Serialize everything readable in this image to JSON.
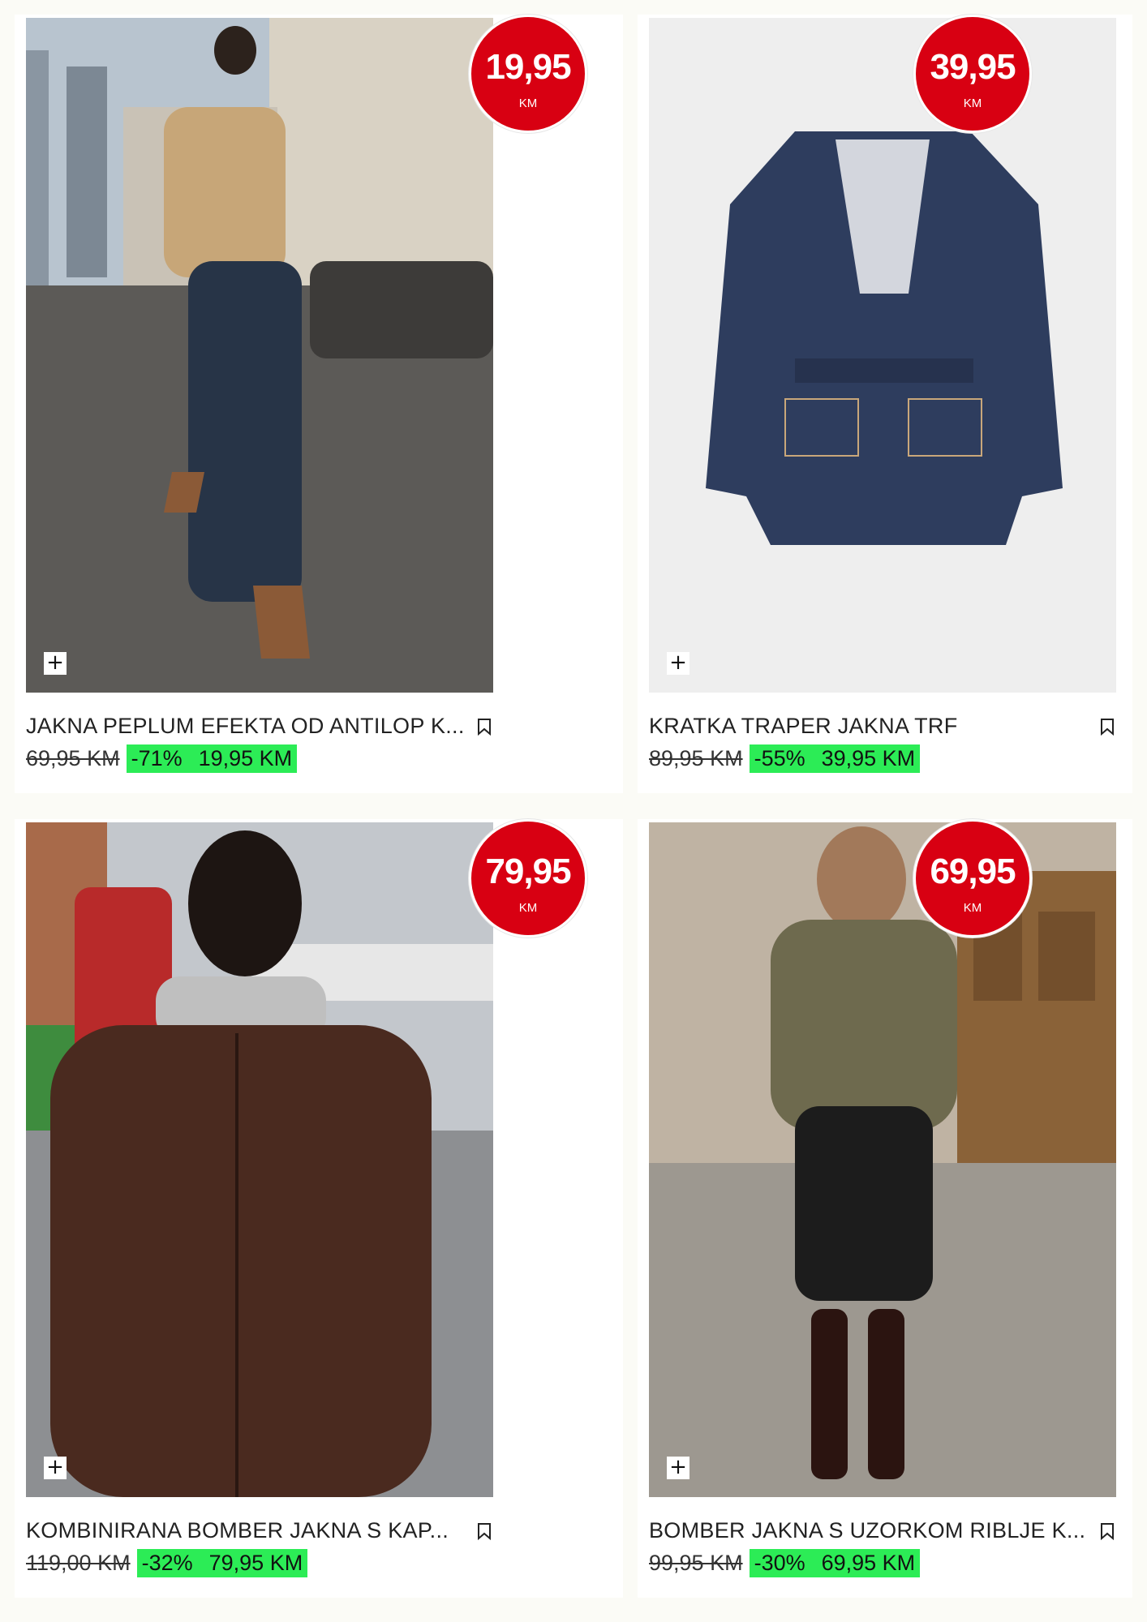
{
  "products": [
    {
      "name": "JAKNA PEPLUM EFEKTA OD ANTILOP K...",
      "bubble_price": "19,95",
      "bubble_currency": "KM",
      "old_price": "69,95 KM",
      "discount": "-71%",
      "new_price": "19,95 KM"
    },
    {
      "name": "KRATKA TRAPER JAKNA TRF",
      "bubble_price": "39,95",
      "bubble_currency": "KM",
      "old_price": "89,95 KM",
      "discount": "-55%",
      "new_price": "39,95 KM"
    },
    {
      "name": "KOMBINIRANA BOMBER JAKNA S KAP...",
      "bubble_price": "79,95",
      "bubble_currency": "KM",
      "old_price": "119,00 KM",
      "discount": "-32%",
      "new_price": "79,95 KM"
    },
    {
      "name": "BOMBER JAKNA S UZORKOM RIBLJE K...",
      "bubble_price": "69,95",
      "bubble_currency": "KM",
      "old_price": "99,95 KM",
      "discount": "-30%",
      "new_price": "69,95 KM"
    }
  ],
  "icons": {
    "add": "plus-icon",
    "save": "bookmark-icon"
  },
  "colors": {
    "bubble": "#d80012",
    "discount_bg": "#2cec56",
    "page_bg": "#fbfbf6"
  },
  "add_symbol": "+"
}
